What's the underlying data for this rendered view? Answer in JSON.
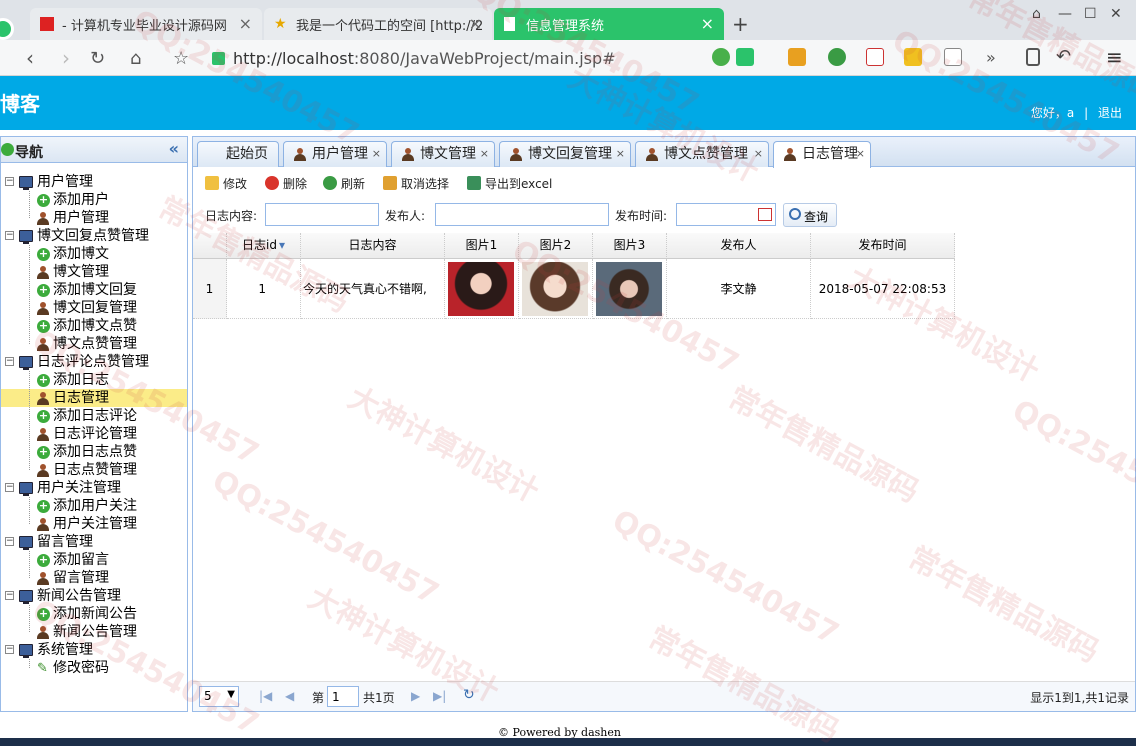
{
  "browser": {
    "tabs": [
      {
        "label": "- 计算机专业毕业设计源码网",
        "close": "×"
      },
      {
        "label": "我是一个代码工的空间 [http://2",
        "close": "×"
      },
      {
        "label": "信息管理系统",
        "close": "×"
      }
    ],
    "new_tab": "+",
    "url_host": "http://localhost",
    "url_rest": ":8080/JavaWebProject/main.jsp#",
    "win_controls": [
      "⌂",
      "—",
      "☐",
      "✕"
    ],
    "more": "»",
    "menu": "≡"
  },
  "app": {
    "title": "博客",
    "greeting": "您好，a",
    "sep": "|",
    "logout": "退出"
  },
  "sidebar": {
    "title": "导航",
    "collapse": "«",
    "groups": [
      {
        "label": "用户管理",
        "items": [
          {
            "label": "添加用户",
            "icon": "add"
          },
          {
            "label": "用户管理",
            "icon": "user"
          }
        ]
      },
      {
        "label": "博文回复点赞管理",
        "items": [
          {
            "label": "添加博文",
            "icon": "add"
          },
          {
            "label": "博文管理",
            "icon": "user"
          },
          {
            "label": "添加博文回复",
            "icon": "add"
          },
          {
            "label": "博文回复管理",
            "icon": "user"
          },
          {
            "label": "添加博文点赞",
            "icon": "add"
          },
          {
            "label": "博文点赞管理",
            "icon": "user"
          }
        ]
      },
      {
        "label": "日志评论点赞管理",
        "items": [
          {
            "label": "添加日志",
            "icon": "add"
          },
          {
            "label": "日志管理",
            "icon": "user",
            "selected": true
          },
          {
            "label": "添加日志评论",
            "icon": "add"
          },
          {
            "label": "日志评论管理",
            "icon": "user"
          },
          {
            "label": "添加日志点赞",
            "icon": "add"
          },
          {
            "label": "日志点赞管理",
            "icon": "user"
          }
        ]
      },
      {
        "label": "用户关注管理",
        "items": [
          {
            "label": "添加用户关注",
            "icon": "add"
          },
          {
            "label": "用户关注管理",
            "icon": "user"
          }
        ]
      },
      {
        "label": "留言管理",
        "items": [
          {
            "label": "添加留言",
            "icon": "add"
          },
          {
            "label": "留言管理",
            "icon": "user"
          }
        ]
      },
      {
        "label": "新闻公告管理",
        "items": [
          {
            "label": "添加新闻公告",
            "icon": "add"
          },
          {
            "label": "新闻公告管理",
            "icon": "user"
          }
        ]
      },
      {
        "label": "系统管理",
        "items": [
          {
            "label": "修改密码",
            "icon": "pen"
          }
        ]
      }
    ]
  },
  "main": {
    "tabs": [
      {
        "label": "起始页",
        "closable": false
      },
      {
        "label": "用户管理",
        "closable": true
      },
      {
        "label": "博文管理",
        "closable": true
      },
      {
        "label": "博文回复管理",
        "closable": true
      },
      {
        "label": "博文点赞管理",
        "closable": true
      },
      {
        "label": "日志管理",
        "closable": true,
        "active": true
      }
    ],
    "tab_close": "×",
    "toolbar": {
      "edit": "修改",
      "delete": "删除",
      "refresh": "刷新",
      "unselect": "取消选择",
      "export": "导出到excel"
    },
    "search": {
      "content_label": "日志内容:",
      "author_label": "发布人:",
      "time_label": "发布时间:",
      "query": "查询",
      "content_value": "",
      "author_value": "",
      "time_value": ""
    },
    "grid": {
      "columns": [
        "日志id",
        "日志内容",
        "图片1",
        "图片2",
        "图片3",
        "发布人",
        "发布时间"
      ],
      "sort_arrow": "▾",
      "rows": [
        {
          "num": "1",
          "id": "1",
          "content": "今天的天气真心不错啊,",
          "author": "李文静",
          "time": "2018-05-07 22:08:53"
        }
      ]
    },
    "pager": {
      "page_size": "5",
      "page_prefix": "第",
      "page_value": "1",
      "page_total": "共1页",
      "summary": "显示1到1,共1记录"
    }
  },
  "footer": "© Powered by dashen",
  "watermarks": [
    "QQ:254540457",
    "大神计算机设计",
    "常年售精品源码"
  ]
}
